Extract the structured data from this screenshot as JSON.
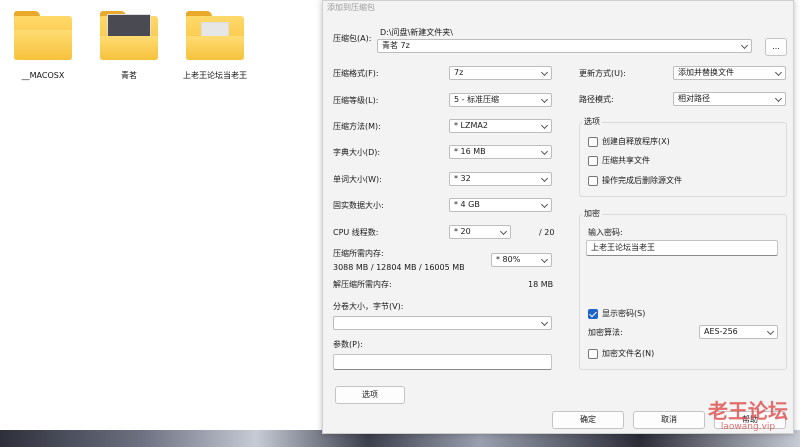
{
  "folders": [
    {
      "label": "__MACOSX"
    },
    {
      "label": "青茗"
    },
    {
      "label": "上老王论坛当老王"
    }
  ],
  "dialog": {
    "title": "添加到压缩包",
    "archive_label": "压缩包(A):",
    "archive_path": "D:\\问盘\\新建文件夹\\",
    "archive_name": "青茗 7z",
    "browse_label": "...",
    "format_label": "压缩格式(F):",
    "format_value": "7z",
    "level_label": "压缩等级(L):",
    "level_value": "5 - 标准压缩",
    "method_label": "压缩方法(M):",
    "method_value": "* LZMA2",
    "dict_label": "字典大小(D):",
    "dict_value": "* 16 MB",
    "word_label": "单词大小(W):",
    "word_value": "* 32",
    "solid_label": "固实数据大小:",
    "solid_value": "* 4 GB",
    "cpu_label": "CPU 线程数:",
    "cpu_value": "* 20",
    "cpu_total": "/ 20",
    "mem_label": "压缩所需内存:",
    "mem_detail": "3088 MB / 12804 MB / 16005 MB",
    "mem_value": "* 80%",
    "decomp_label": "解压缩所需内存:",
    "decomp_value": "18 MB",
    "split_label": "分卷大小，字节(V):",
    "split_value": "",
    "params_label": "参数(P):",
    "params_value": "",
    "options_button": "选项",
    "update_label": "更新方式(U):",
    "update_value": "添加并替换文件",
    "path_label": "路径模式:",
    "path_value": "相对路径",
    "options_group": "选项",
    "opt_sfx": "创建自释放程序(X)",
    "opt_shared": "压缩共享文件",
    "opt_delete": "操作完成后删除源文件",
    "encrypt_group": "加密",
    "password_label": "输入密码:",
    "password_value": "上老王论坛当老王",
    "show_password": "显示密码(S)",
    "enc_method_label": "加密算法:",
    "enc_method_value": "AES-256",
    "encrypt_names": "加密文件名(N)",
    "ok": "确定",
    "cancel": "取消",
    "help": "帮助"
  },
  "watermark": {
    "big": "老王论坛",
    "small": "laowang.vip"
  },
  "colors": {
    "accent": "#1e64c8",
    "folder": "#f5be35",
    "watermark": "#e05555"
  }
}
